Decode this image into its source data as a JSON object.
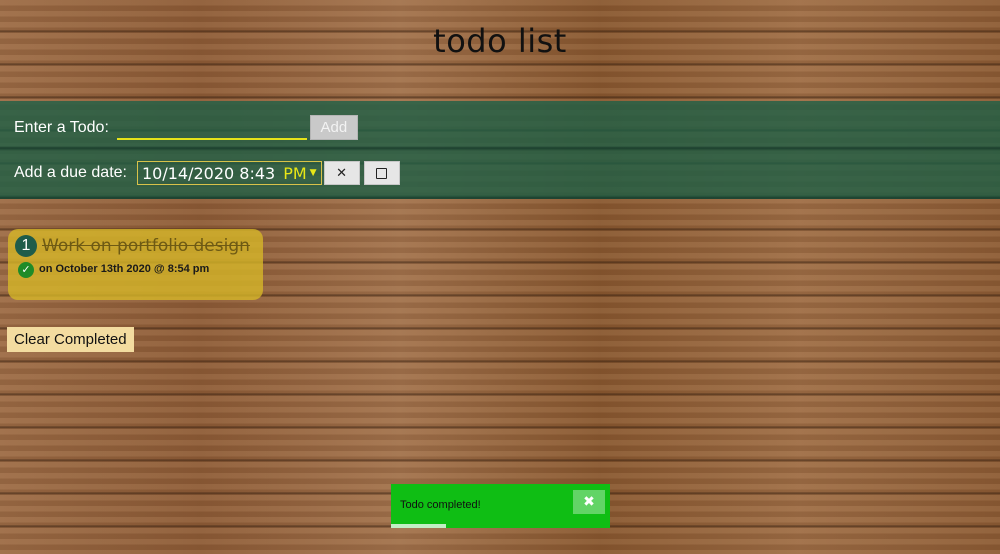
{
  "header": {
    "title": "todo list"
  },
  "form": {
    "todo_label": "Enter a Todo:",
    "todo_value": "",
    "add_label": "Add",
    "due_label": "Add a due date:",
    "date_value": "10/14/2020 8:43",
    "ampm": "PM",
    "clear_icon": "close-icon",
    "calendar_icon": "calendar-icon"
  },
  "todos": [
    {
      "number": "1",
      "text": "Work on portfolio design",
      "completed": true,
      "due": "on October 13th 2020 @ 8:54 pm"
    }
  ],
  "actions": {
    "clear_completed": "Clear Completed"
  },
  "toast": {
    "message": "Todo completed!",
    "progress": 0.25
  },
  "colors": {
    "band": "#1e5f46",
    "card": "#d6b628",
    "toast": "#0fbe14",
    "accent": "#e8e617"
  }
}
